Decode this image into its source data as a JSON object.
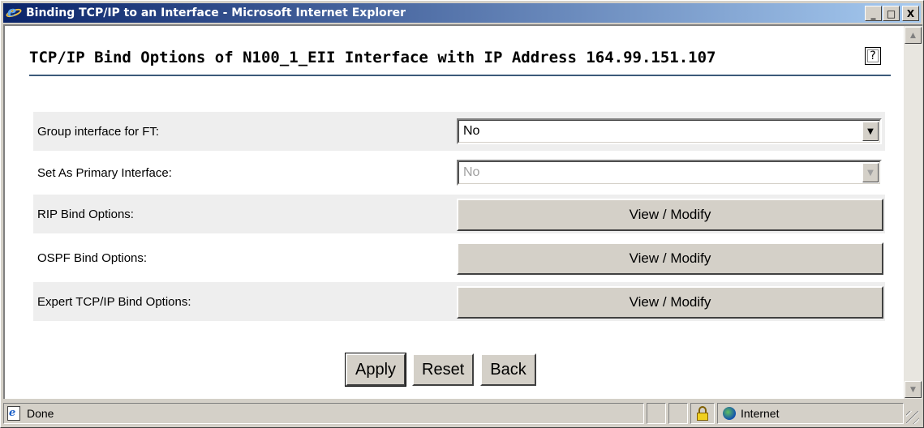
{
  "window": {
    "title": "Binding TCP/IP to an Interface - Microsoft Internet Explorer",
    "minimize": "_",
    "maximize": "□",
    "close": "X"
  },
  "page": {
    "title": "TCP/IP Bind Options of N100_1_EII Interface with IP Address 164.99.151.107",
    "help_symbol": "?"
  },
  "rows": [
    {
      "label": "Group interface for FT:",
      "control": "select",
      "value": "No",
      "enabled": true
    },
    {
      "label": "Set As Primary Interface:",
      "control": "select",
      "value": "No",
      "enabled": false
    },
    {
      "label": "RIP Bind Options:",
      "control": "button",
      "value": "View / Modify"
    },
    {
      "label": "OSPF Bind Options:",
      "control": "button",
      "value": "View / Modify"
    },
    {
      "label": "Expert TCP/IP Bind Options:",
      "control": "button",
      "value": "View / Modify"
    }
  ],
  "actions": {
    "apply": "Apply",
    "reset": "Reset",
    "back": "Back"
  },
  "status": {
    "text": "Done",
    "zone": "Internet"
  },
  "icons": {
    "arrow_down": "▼",
    "arrow_up": "▲"
  }
}
